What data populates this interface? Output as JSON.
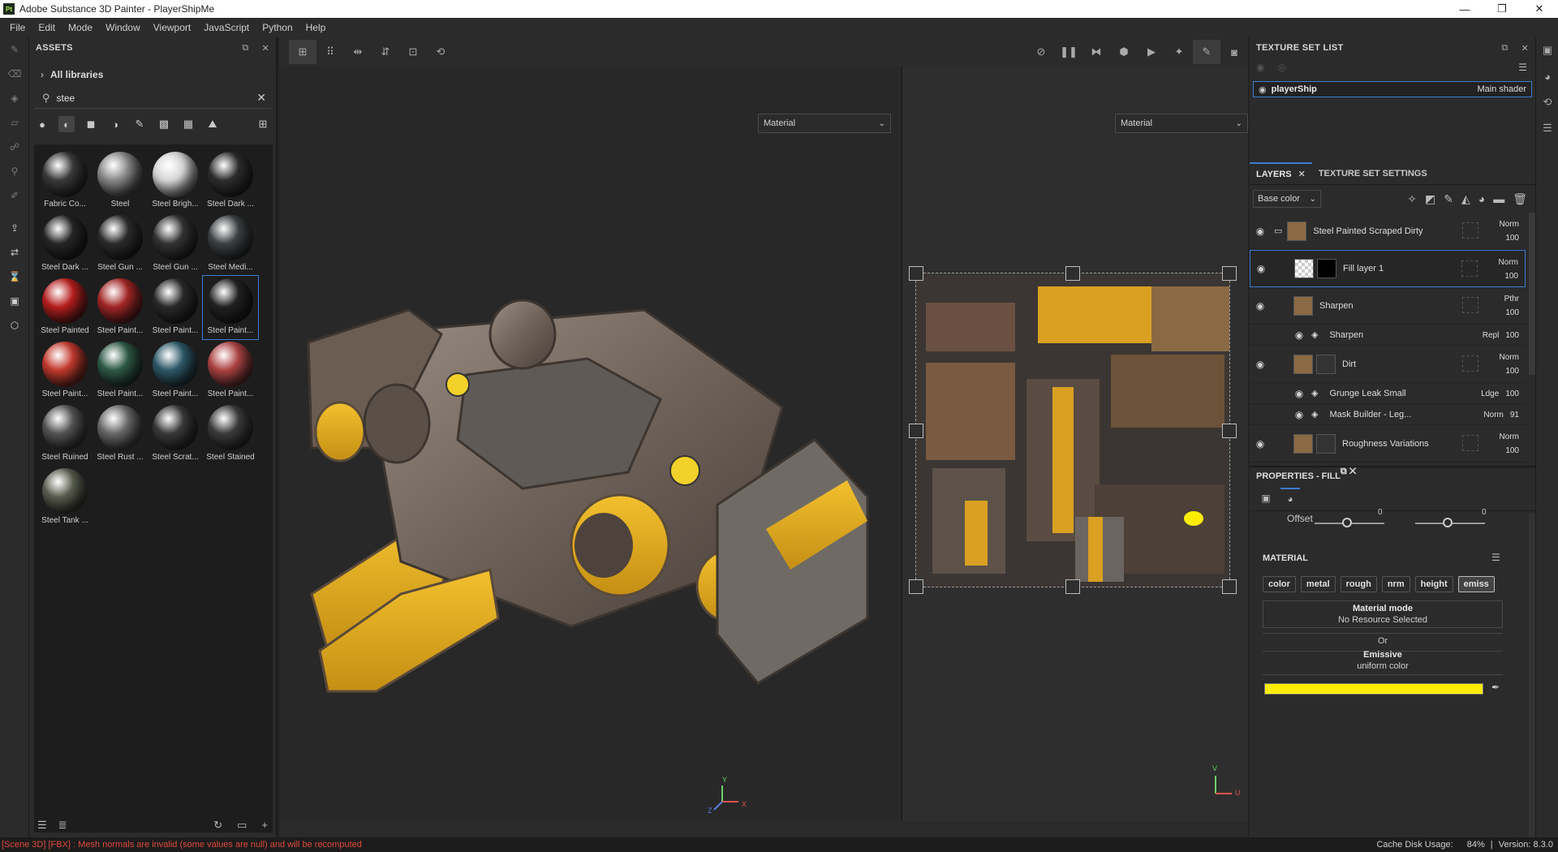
{
  "window": {
    "title": "Adobe Substance 3D Painter - PlayerShipMe",
    "logo": "Pt"
  },
  "menu": [
    "File",
    "Edit",
    "Mode",
    "Window",
    "Viewport",
    "JavaScript",
    "Python",
    "Help"
  ],
  "assets": {
    "title": "ASSETS",
    "library": "All libraries",
    "search_value": "stee",
    "items": [
      {
        "label": "Fabric Co...",
        "color": "#3a3a3a"
      },
      {
        "label": "Steel",
        "color": "#8a8a8a"
      },
      {
        "label": "Steel Brigh...",
        "color": "#d8d8d8"
      },
      {
        "label": "Steel Dark ...",
        "color": "#2e2e2e"
      },
      {
        "label": "Steel Dark ...",
        "color": "#262626"
      },
      {
        "label": "Steel Gun ...",
        "color": "#2c2c2c"
      },
      {
        "label": "Steel Gun ...",
        "color": "#333333"
      },
      {
        "label": "Steel Medi...",
        "color": "#3c4244"
      },
      {
        "label": "Steel Painted",
        "color": "#b91e1e"
      },
      {
        "label": "Steel Paint...",
        "color": "#a52626"
      },
      {
        "label": "Steel Paint...",
        "color": "#2a2a2a"
      },
      {
        "label": "Steel Paint...",
        "color": "#222222"
      },
      {
        "label": "Steel Paint...",
        "color": "#c43a2e"
      },
      {
        "label": "Steel Paint...",
        "color": "#2f5a48"
      },
      {
        "label": "Steel Paint...",
        "color": "#2e5a6a"
      },
      {
        "label": "Steel Paint...",
        "color": "#b04444"
      },
      {
        "label": "Steel Ruined",
        "color": "#555555"
      },
      {
        "label": "Steel Rust ...",
        "color": "#6a6a6a"
      },
      {
        "label": "Steel Scrat...",
        "color": "#3a3a3a"
      },
      {
        "label": "Steel Stained",
        "color": "#3c3c3c"
      },
      {
        "label": "Steel Tank ...",
        "color": "#5a5e50"
      }
    ]
  },
  "viewport": {
    "left_mode": "Material",
    "right_mode": "Material",
    "axis_3d": {
      "x": "X",
      "y": "Y",
      "z": "Z"
    },
    "axis_2d": {
      "u": "U",
      "v": "V"
    }
  },
  "texture_set_list": {
    "title": "TEXTURE SET LIST",
    "set_name": "playerShip",
    "shader": "Main shader"
  },
  "layers": {
    "tab_layers": "LAYERS",
    "tab_settings": "TEXTURE SET SETTINGS",
    "channel": "Base color",
    "items": [
      {
        "name": "Steel Painted Scraped Dirty",
        "blend": "Norm",
        "opacity": "100",
        "kind": "folder"
      },
      {
        "name": "Fill layer 1",
        "blend": "Norm",
        "opacity": "100",
        "kind": "fill",
        "selected": true
      },
      {
        "name": "Sharpen",
        "blend": "Pthr",
        "opacity": "100",
        "kind": "filter"
      },
      {
        "name": "Sharpen",
        "blend": "Repl",
        "opacity": "100",
        "kind": "sub"
      },
      {
        "name": "Dirt",
        "blend": "Norm",
        "opacity": "100",
        "kind": "layer"
      },
      {
        "name": "Grunge Leak Small",
        "blend": "Ldge",
        "opacity": "100",
        "kind": "sub"
      },
      {
        "name": "Mask Builder - Leg...",
        "blend": "Norm",
        "opacity": "91",
        "kind": "sub"
      },
      {
        "name": "Roughness Variations",
        "blend": "Norm",
        "opacity": "100",
        "kind": "layer"
      }
    ]
  },
  "properties": {
    "title": "PROPERTIES - FILL",
    "offset_label": "Offset",
    "offset_u": "0",
    "offset_v": "0",
    "material_title": "MATERIAL",
    "channels": [
      "color",
      "metal",
      "rough",
      "nrm",
      "height",
      "emiss"
    ],
    "material_mode_label": "Material mode",
    "material_mode_value": "No Resource Selected",
    "or_label": "Or",
    "emissive_label": "Emissive",
    "emissive_value": "uniform color",
    "emissive_color": "#ffee00"
  },
  "status": {
    "error": "[Scene 3D] [FBX] : Mesh normals are invalid (some values are null) and will be recomputed",
    "cache": "Cache Disk Usage:",
    "cache_value": "84%",
    "version": "Version: 8.3.0"
  }
}
